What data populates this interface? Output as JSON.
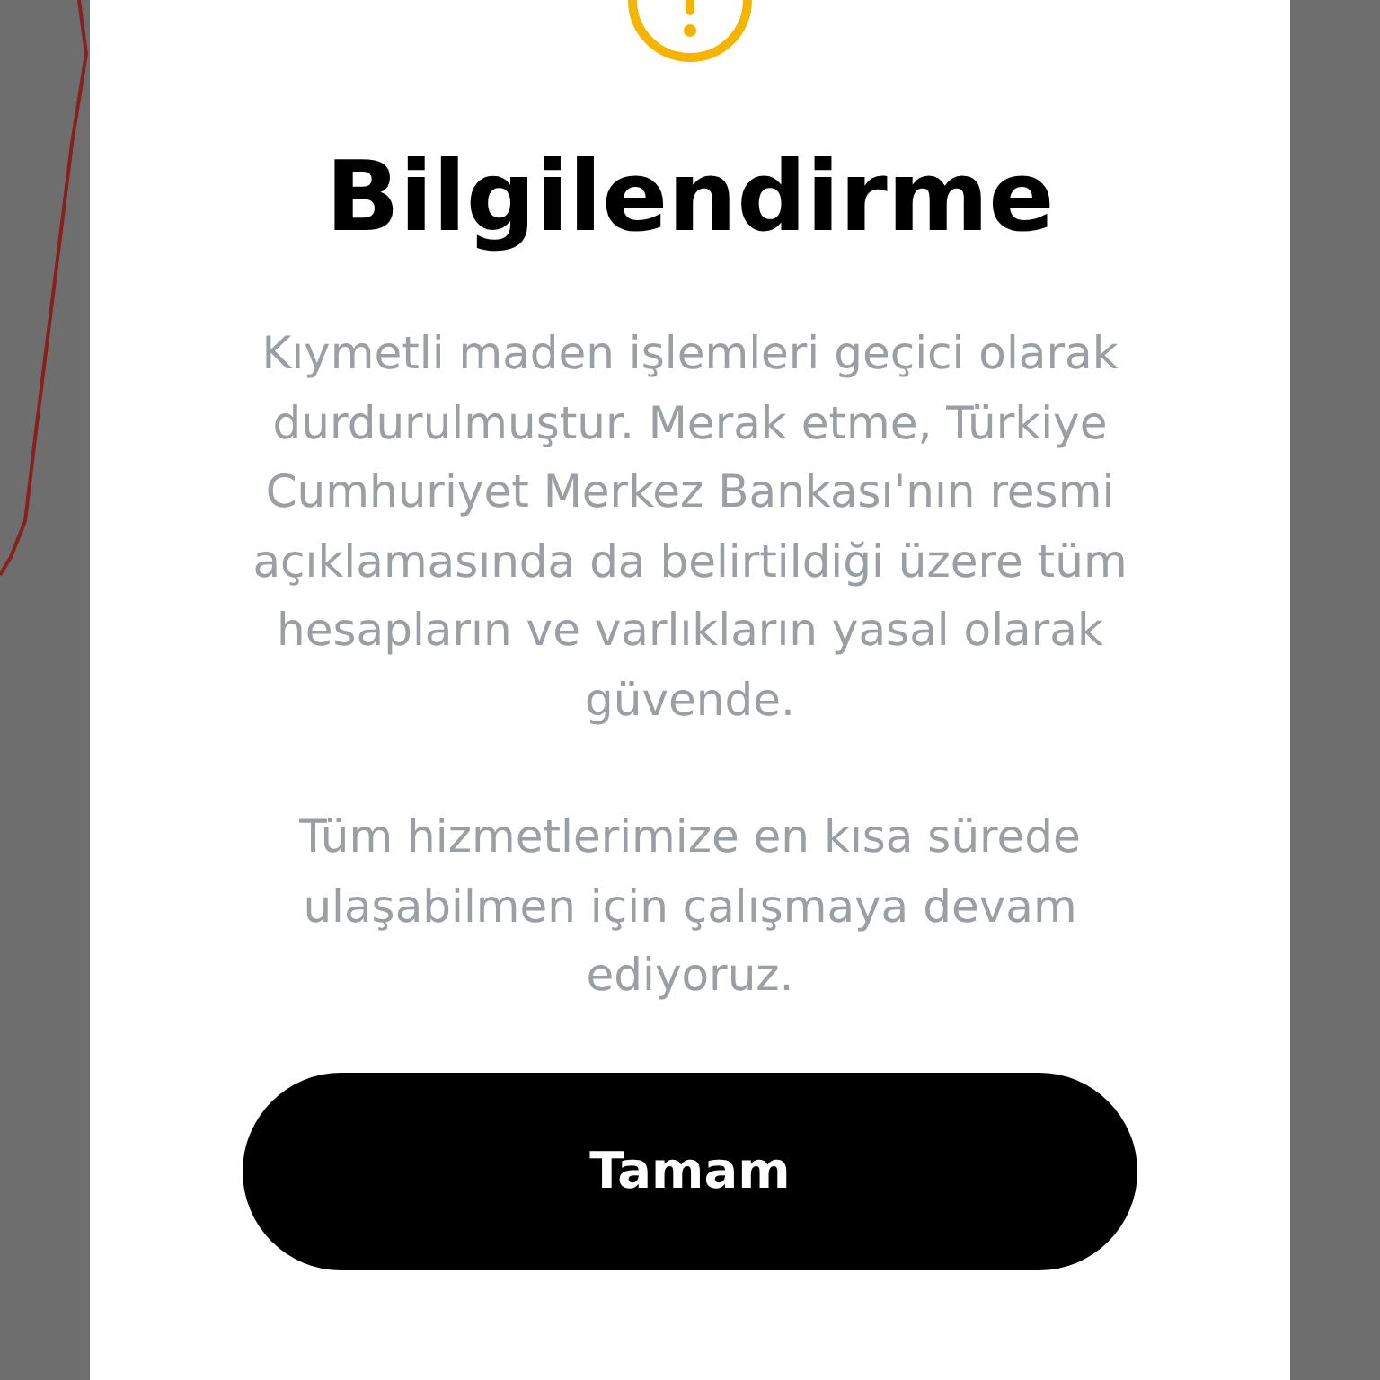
{
  "dialog": {
    "title": "Bilgilendirme",
    "paragraphs": [
      "Kıymetli maden işlemleri geçici olarak durdurulmuştur. Merak etme, Türkiye Cumhuriyet Merkez Bankası'nın resmi açıklamasında da belirtildiği üzere tüm hesapların ve varlıkların yasal olarak güvende.",
      "Tüm hizmetlerimize en kısa sürede ulaşabilmen için çalışmaya devam ediyoruz."
    ],
    "button": "Tamam"
  }
}
